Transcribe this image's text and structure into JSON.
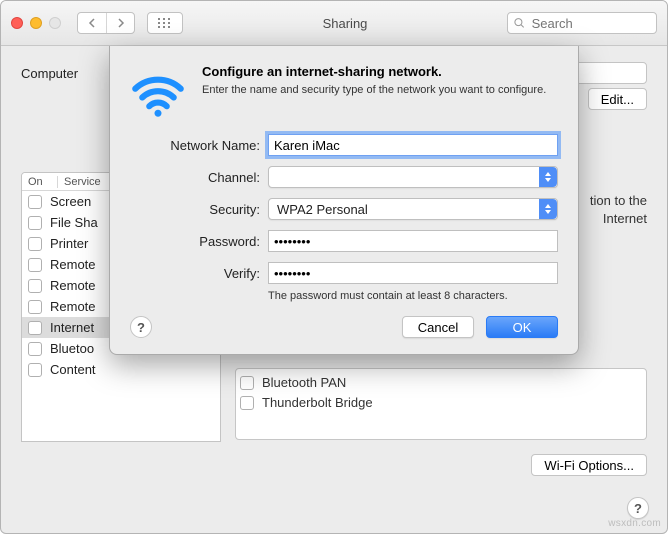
{
  "titlebar": {
    "title": "Sharing",
    "search_placeholder": "Search"
  },
  "header": {
    "computer_label": "Computer",
    "edit_label": "Edit..."
  },
  "services": {
    "col_on": "On",
    "col_service": "Service",
    "items": [
      {
        "label": "Screen"
      },
      {
        "label": "File Sha"
      },
      {
        "label": "Printer"
      },
      {
        "label": "Remote"
      },
      {
        "label": "Remote"
      },
      {
        "label": "Remote"
      },
      {
        "label": "Internet"
      },
      {
        "label": "Bluetoo"
      },
      {
        "label": "Content"
      }
    ],
    "selected_index": 6
  },
  "right": {
    "desc_tail_1": "tion to the",
    "desc_tail_2": "Internet",
    "port_bluetooth": "Bluetooth PAN",
    "port_thunderbolt": "Thunderbolt Bridge",
    "wifi_options": "Wi-Fi Options..."
  },
  "sheet": {
    "title": "Configure an internet-sharing network.",
    "subtitle": "Enter the name and security type of the network you want to configure.",
    "labels": {
      "network_name": "Network Name:",
      "channel": "Channel:",
      "security": "Security:",
      "password": "Password:",
      "verify": "Verify:"
    },
    "values": {
      "network_name": "Karen iMac",
      "channel": "",
      "security": "WPA2 Personal",
      "password": "••••••••",
      "verify": "••••••••"
    },
    "hint": "The password must contain at least 8 characters.",
    "buttons": {
      "cancel": "Cancel",
      "ok": "OK"
    }
  },
  "watermark": "wsxdn.com"
}
